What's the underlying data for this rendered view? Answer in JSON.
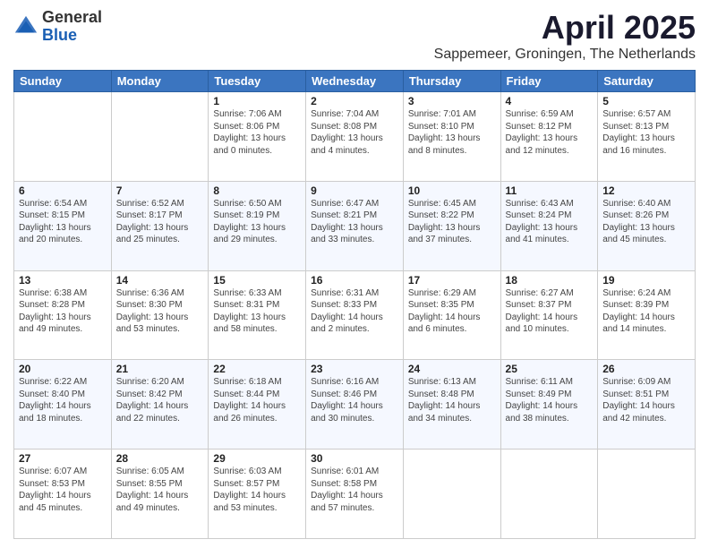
{
  "logo": {
    "general": "General",
    "blue": "Blue"
  },
  "title": {
    "month_year": "April 2025",
    "location": "Sappemeer, Groningen, The Netherlands"
  },
  "days_of_week": [
    "Sunday",
    "Monday",
    "Tuesday",
    "Wednesday",
    "Thursday",
    "Friday",
    "Saturday"
  ],
  "weeks": [
    [
      {
        "day": "",
        "info": ""
      },
      {
        "day": "",
        "info": ""
      },
      {
        "day": "1",
        "info": "Sunrise: 7:06 AM\nSunset: 8:06 PM\nDaylight: 13 hours and 0 minutes."
      },
      {
        "day": "2",
        "info": "Sunrise: 7:04 AM\nSunset: 8:08 PM\nDaylight: 13 hours and 4 minutes."
      },
      {
        "day": "3",
        "info": "Sunrise: 7:01 AM\nSunset: 8:10 PM\nDaylight: 13 hours and 8 minutes."
      },
      {
        "day": "4",
        "info": "Sunrise: 6:59 AM\nSunset: 8:12 PM\nDaylight: 13 hours and 12 minutes."
      },
      {
        "day": "5",
        "info": "Sunrise: 6:57 AM\nSunset: 8:13 PM\nDaylight: 13 hours and 16 minutes."
      }
    ],
    [
      {
        "day": "6",
        "info": "Sunrise: 6:54 AM\nSunset: 8:15 PM\nDaylight: 13 hours and 20 minutes."
      },
      {
        "day": "7",
        "info": "Sunrise: 6:52 AM\nSunset: 8:17 PM\nDaylight: 13 hours and 25 minutes."
      },
      {
        "day": "8",
        "info": "Sunrise: 6:50 AM\nSunset: 8:19 PM\nDaylight: 13 hours and 29 minutes."
      },
      {
        "day": "9",
        "info": "Sunrise: 6:47 AM\nSunset: 8:21 PM\nDaylight: 13 hours and 33 minutes."
      },
      {
        "day": "10",
        "info": "Sunrise: 6:45 AM\nSunset: 8:22 PM\nDaylight: 13 hours and 37 minutes."
      },
      {
        "day": "11",
        "info": "Sunrise: 6:43 AM\nSunset: 8:24 PM\nDaylight: 13 hours and 41 minutes."
      },
      {
        "day": "12",
        "info": "Sunrise: 6:40 AM\nSunset: 8:26 PM\nDaylight: 13 hours and 45 minutes."
      }
    ],
    [
      {
        "day": "13",
        "info": "Sunrise: 6:38 AM\nSunset: 8:28 PM\nDaylight: 13 hours and 49 minutes."
      },
      {
        "day": "14",
        "info": "Sunrise: 6:36 AM\nSunset: 8:30 PM\nDaylight: 13 hours and 53 minutes."
      },
      {
        "day": "15",
        "info": "Sunrise: 6:33 AM\nSunset: 8:31 PM\nDaylight: 13 hours and 58 minutes."
      },
      {
        "day": "16",
        "info": "Sunrise: 6:31 AM\nSunset: 8:33 PM\nDaylight: 14 hours and 2 minutes."
      },
      {
        "day": "17",
        "info": "Sunrise: 6:29 AM\nSunset: 8:35 PM\nDaylight: 14 hours and 6 minutes."
      },
      {
        "day": "18",
        "info": "Sunrise: 6:27 AM\nSunset: 8:37 PM\nDaylight: 14 hours and 10 minutes."
      },
      {
        "day": "19",
        "info": "Sunrise: 6:24 AM\nSunset: 8:39 PM\nDaylight: 14 hours and 14 minutes."
      }
    ],
    [
      {
        "day": "20",
        "info": "Sunrise: 6:22 AM\nSunset: 8:40 PM\nDaylight: 14 hours and 18 minutes."
      },
      {
        "day": "21",
        "info": "Sunrise: 6:20 AM\nSunset: 8:42 PM\nDaylight: 14 hours and 22 minutes."
      },
      {
        "day": "22",
        "info": "Sunrise: 6:18 AM\nSunset: 8:44 PM\nDaylight: 14 hours and 26 minutes."
      },
      {
        "day": "23",
        "info": "Sunrise: 6:16 AM\nSunset: 8:46 PM\nDaylight: 14 hours and 30 minutes."
      },
      {
        "day": "24",
        "info": "Sunrise: 6:13 AM\nSunset: 8:48 PM\nDaylight: 14 hours and 34 minutes."
      },
      {
        "day": "25",
        "info": "Sunrise: 6:11 AM\nSunset: 8:49 PM\nDaylight: 14 hours and 38 minutes."
      },
      {
        "day": "26",
        "info": "Sunrise: 6:09 AM\nSunset: 8:51 PM\nDaylight: 14 hours and 42 minutes."
      }
    ],
    [
      {
        "day": "27",
        "info": "Sunrise: 6:07 AM\nSunset: 8:53 PM\nDaylight: 14 hours and 45 minutes."
      },
      {
        "day": "28",
        "info": "Sunrise: 6:05 AM\nSunset: 8:55 PM\nDaylight: 14 hours and 49 minutes."
      },
      {
        "day": "29",
        "info": "Sunrise: 6:03 AM\nSunset: 8:57 PM\nDaylight: 14 hours and 53 minutes."
      },
      {
        "day": "30",
        "info": "Sunrise: 6:01 AM\nSunset: 8:58 PM\nDaylight: 14 hours and 57 minutes."
      },
      {
        "day": "",
        "info": ""
      },
      {
        "day": "",
        "info": ""
      },
      {
        "day": "",
        "info": ""
      }
    ]
  ]
}
